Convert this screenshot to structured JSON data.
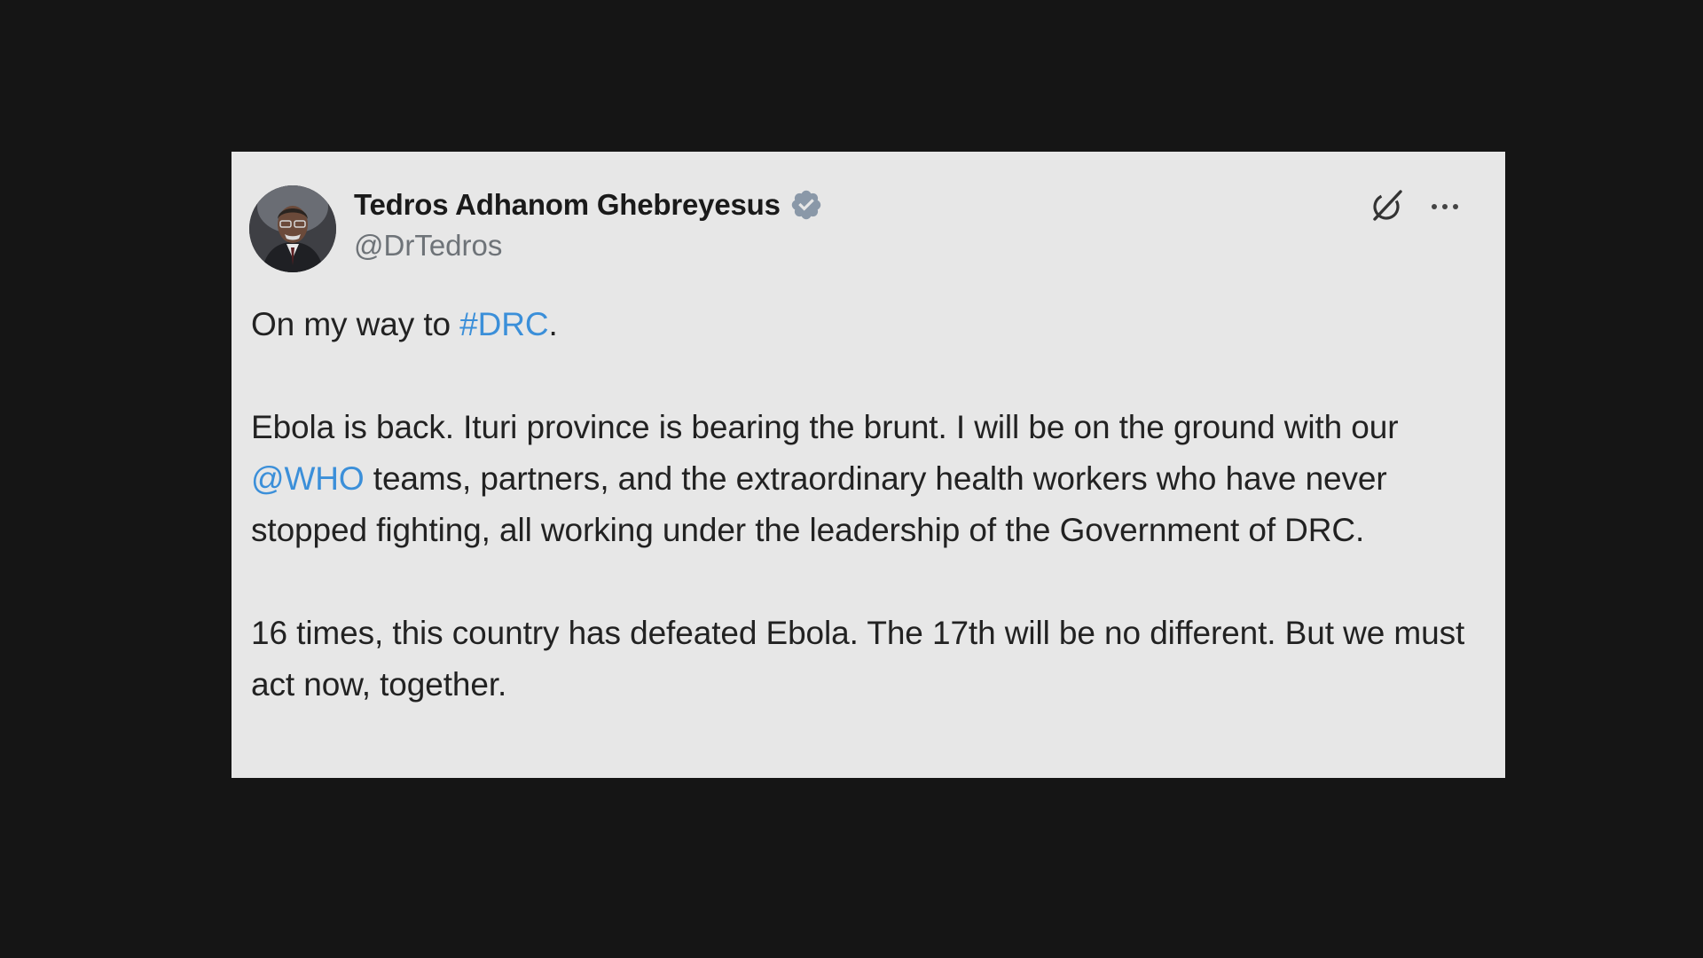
{
  "tweet": {
    "author_name": "Tedros Adhanom Ghebreyesus",
    "author_handle": "@DrTedros",
    "verified": true,
    "accent_color": "#3b8fd9",
    "verified_badge_color": "#8a98a8",
    "icons": {
      "avatar": "profile-photo",
      "verified": "verified-badge-icon",
      "grok": "grok-icon",
      "more": "more-options-icon"
    },
    "paragraph1": {
      "text_before": "On my way to ",
      "hashtag": "#DRC",
      "text_after": "."
    },
    "paragraph2": {
      "text_before": "Ebola is back. Ituri province is bearing the brunt. I will be on the ground with our ",
      "mention": "@WHO",
      "text_after": " teams, partners, and the extraordinary health workers who have never stopped fighting, all working under the leadership of the Government of DRC."
    },
    "paragraph3": {
      "text": "16 times, this country has defeated Ebola. The 17th will be no different. But we must act now, together."
    }
  }
}
